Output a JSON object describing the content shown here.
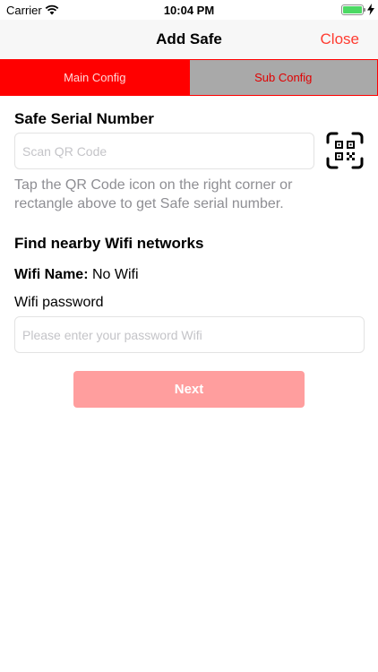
{
  "status_bar": {
    "carrier": "Carrier",
    "time": "10:04 PM",
    "battery_level": 1.0,
    "battery_color": "#4cd964"
  },
  "nav": {
    "title": "Add Safe",
    "close_label": "Close",
    "accent_color": "#ff3b30"
  },
  "tabs": [
    {
      "label": "Main Config",
      "selected": true
    },
    {
      "label": "Sub Config",
      "selected": false
    }
  ],
  "serial": {
    "title": "Safe Serial Number",
    "placeholder": "Scan QR Code",
    "value": "",
    "hint": "Tap the QR Code icon on the right corner or rectangle above to get Safe serial number.",
    "qr_icon": "qr-code-icon"
  },
  "wifi": {
    "title": "Find nearby Wifi networks",
    "name_label": "Wifi Name:",
    "name_value": " No Wifi",
    "password_label": "Wifi password",
    "password_placeholder": "Please enter your password Wifi",
    "password_value": ""
  },
  "next_label": "Next",
  "next_color": "#ff9e9e"
}
